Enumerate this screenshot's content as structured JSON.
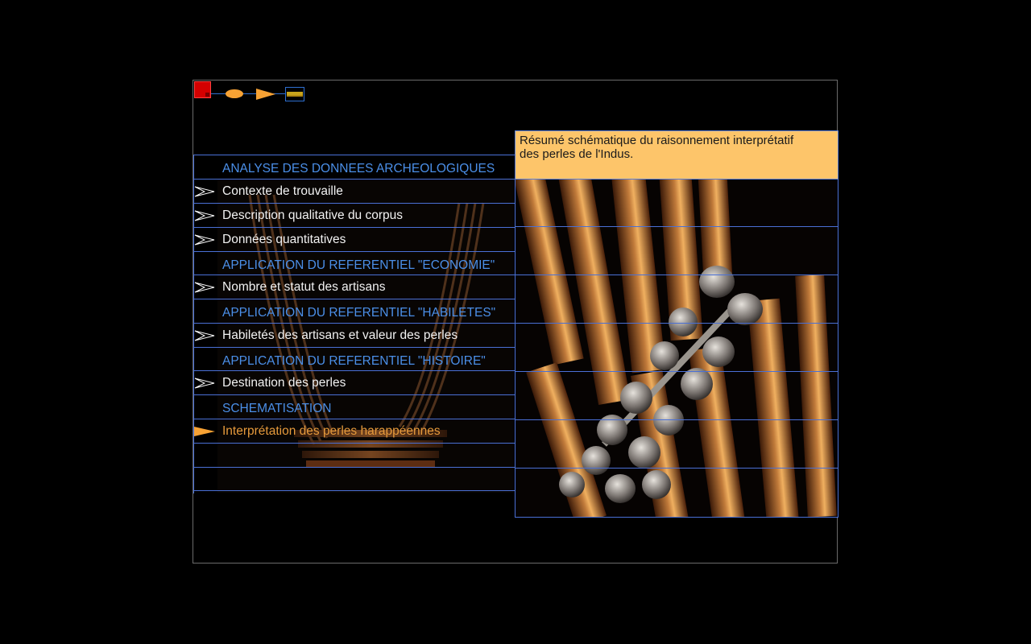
{
  "title": {
    "line1": "Résumé schématique du raisonnement interprétatif",
    "line2": "des perles de l'Indus."
  },
  "nav": {
    "icons": [
      "home-square-icon",
      "oval-icon",
      "forward-arrow-icon",
      "bars-icon"
    ]
  },
  "menu": [
    {
      "label": "ANALYSE DES DONNEES ARCHEOLOGIQUES",
      "kind": "heading"
    },
    {
      "label": "Contexte de trouvaille",
      "kind": "item"
    },
    {
      "label": "Description qualitative du corpus",
      "kind": "item"
    },
    {
      "label": "Données quantitatives",
      "kind": "item"
    },
    {
      "label": "APPLICATION DU REFERENTIEL \"ECONOMIE\"",
      "kind": "heading"
    },
    {
      "label": "Nombre et statut des artisans",
      "kind": "item"
    },
    {
      "label": "APPLICATION DU REFERENTIEL \"HABILETES\"",
      "kind": "heading"
    },
    {
      "label": "Habiletés des artisans et valeur des perles",
      "kind": "item"
    },
    {
      "label": "APPLICATION DU REFERENTIEL \"HISTOIRE\"",
      "kind": "heading"
    },
    {
      "label": "Destination des perles",
      "kind": "item"
    },
    {
      "label": "SCHEMATISATION",
      "kind": "heading"
    },
    {
      "label": "Interprétation des perles harappéennes",
      "kind": "active"
    },
    {
      "label": "",
      "kind": "empty"
    },
    {
      "label": "",
      "kind": "empty"
    }
  ],
  "colors": {
    "heading": "#4b8fe8",
    "item": "#f2f2f2",
    "active": "#e69a3c",
    "title_bg": "#fdc56a",
    "grid": "#4a70d6"
  }
}
